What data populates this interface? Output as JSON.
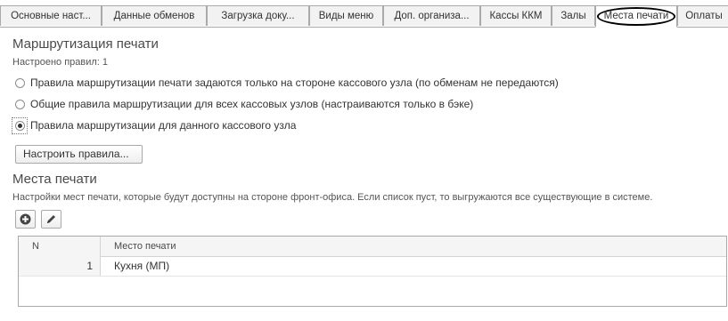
{
  "tabs": [
    {
      "label": "Основные наст..."
    },
    {
      "label": "Данные обменов"
    },
    {
      "label": "Загрузка доку..."
    },
    {
      "label": "Виды меню"
    },
    {
      "label": "Доп. организа..."
    },
    {
      "label": "Кассы ККМ"
    },
    {
      "label": "Залы"
    },
    {
      "label": "Места печати",
      "active": true
    },
    {
      "label": "Оплаты"
    }
  ],
  "routing": {
    "title": "Маршрутизация печати",
    "rules_count": "Настроено правил: 1",
    "options": [
      {
        "label": "Правила маршрутизации печати задаются только на стороне кассового узла (по обменам не передаются)",
        "checked": false
      },
      {
        "label": "Общие правила маршрутизации для всех кассовых узлов (настраиваются только в бэке)",
        "checked": false
      },
      {
        "label": "Правила маршрутизации для данного кассового узла",
        "checked": true
      }
    ],
    "configure_button": "Настроить правила..."
  },
  "print_places": {
    "title": "Места печати",
    "description": "Настройки мест печати, которые будут доступны на стороне фронт-офиса. Если список пуст, то выгружаются все существующие в системе.",
    "toolbar": {
      "add_icon": "plus-circle-icon",
      "edit_icon": "pencil-icon"
    },
    "columns": {
      "n": "N",
      "place": "Место печати"
    },
    "rows": [
      {
        "n": "1",
        "place": "Кухня (МП)"
      }
    ]
  }
}
